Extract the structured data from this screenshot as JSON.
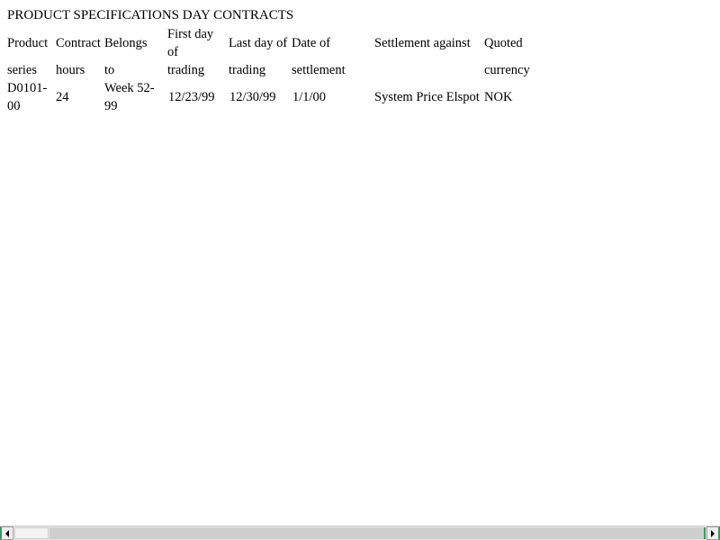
{
  "page": {
    "title": "PRODUCT SPECIFICATIONS DAY CONTRACTS"
  },
  "table": {
    "headers": [
      [
        "Product",
        "series"
      ],
      [
        "Contract",
        "hours"
      ],
      [
        "Belongs",
        "to"
      ],
      [
        "First day",
        "of",
        "trading"
      ],
      [
        "Last day of",
        "trading"
      ],
      [
        "Date of",
        "settlement"
      ],
      [
        "Settlement against"
      ],
      [
        "Quoted",
        "currency"
      ]
    ],
    "rows": [
      [
        [
          "D0101-",
          "00"
        ],
        [
          "24"
        ],
        [
          "Week 52-",
          "99"
        ],
        [
          "12/23/99"
        ],
        [
          "12/30/99"
        ],
        [
          "1/1/00"
        ],
        [
          "System Price Elspot"
        ],
        [
          "NOK"
        ]
      ]
    ]
  },
  "scrollbar": {
    "left_icon": "arrow-left-icon",
    "right_icon": "arrow-right-icon"
  }
}
